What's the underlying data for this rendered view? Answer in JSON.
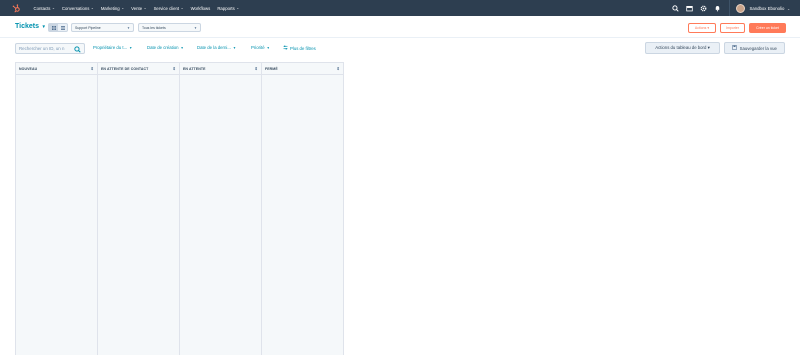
{
  "nav": {
    "items": [
      {
        "label": "Contacts"
      },
      {
        "label": "Conversations"
      },
      {
        "label": "Marketing"
      },
      {
        "label": "Vente"
      },
      {
        "label": "Service client"
      },
      {
        "label": "Workflows",
        "no_caret": true
      },
      {
        "label": "Rapports"
      }
    ],
    "account_name": "Sandbox Ebonolio",
    "brand_color": "#ff7a59",
    "bar_color": "#2d3e50"
  },
  "header": {
    "title": "Tickets",
    "pipeline_select": "Support Pipeline",
    "tickets_select": "Tous les tickets",
    "actions_label": "Actions ▾",
    "import_label": "Importer",
    "create_label": "Créer un ticket"
  },
  "filters": {
    "search_placeholder": "Rechercher un ID, un n",
    "owner": "Propriétaire du t...",
    "created": "Date de création",
    "last_activity": "Date de la derni...",
    "priority": "Priorité",
    "more_filters": "Plus de filtres",
    "board_actions": "Actions du tableau de bord ▾",
    "save_view": "Sauvegarder la vue"
  },
  "board": {
    "columns": [
      {
        "label": "NOUVEAU"
      },
      {
        "label": "EN ATTENTE DE CONTACT"
      },
      {
        "label": "EN ATTENTE"
      },
      {
        "label": "FERMÉ"
      }
    ]
  }
}
